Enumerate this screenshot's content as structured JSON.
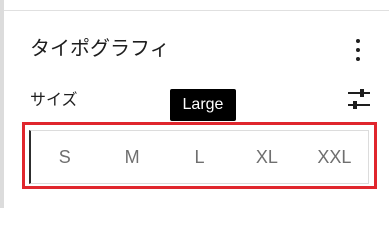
{
  "panel": {
    "title": "タイポグラフィ",
    "more_icon": "vertical-ellipsis-icon",
    "settings_icon": "sliders-icon"
  },
  "size": {
    "label": "サイズ",
    "tooltip": "Large",
    "options": [
      "S",
      "M",
      "L",
      "XL",
      "XXL"
    ]
  },
  "colors": {
    "highlight": "#e0262d",
    "tooltip_bg": "#000000",
    "text": "#1e1e1e",
    "option_text": "#6f6f6f"
  }
}
